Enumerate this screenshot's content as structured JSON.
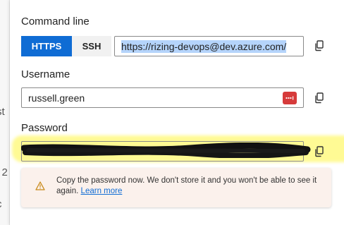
{
  "background": {
    "fragments": [
      "st",
      "l 2",
      "c"
    ]
  },
  "command_line": {
    "label": "Command line",
    "protocols": [
      {
        "label": "HTTPS",
        "active": true
      },
      {
        "label": "SSH",
        "active": false
      }
    ],
    "url": "https://rizing-devops@dev.azure.com/"
  },
  "username": {
    "label": "Username",
    "value": "russell.green"
  },
  "password": {
    "label": "Password",
    "redacted": true
  },
  "notice": {
    "message": "Copy the password now. We don't store it and you won't be able to see it again.",
    "link": "Learn more"
  },
  "icons": {
    "copy": "copy-icon",
    "warning": "warning-icon",
    "password_manager": "password-manager-icon"
  },
  "colors": {
    "accent": "#0f6cd4",
    "highlight": "#b5d4fb",
    "annotation": "#fff53c",
    "notice_bg": "#fbf1ec",
    "warning": "#c98a1a",
    "password_manager_badge": "#d63b3b"
  }
}
